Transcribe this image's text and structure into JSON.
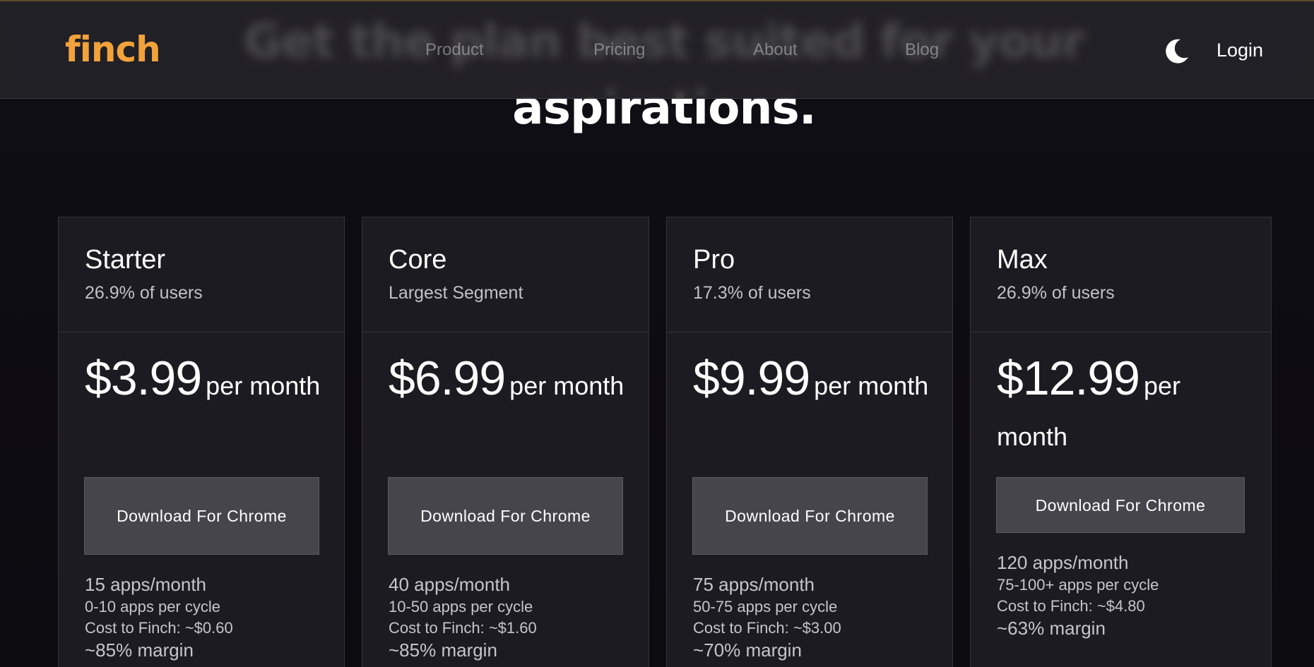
{
  "hero": {
    "title": "Get the plan best suited for your aspirations."
  },
  "nav": {
    "logo": "finch",
    "links": [
      "Product",
      "Pricing",
      "About",
      "Blog"
    ],
    "theme_icon": "moon-icon",
    "login": "Login"
  },
  "colors": {
    "brand": "#f2a23a",
    "background": "#0f0d14",
    "card": "#1c1b21",
    "button": "#46454c"
  },
  "plans": [
    {
      "name": "Starter",
      "sub": "26.9% of users",
      "price": "$3.99",
      "per": "per month",
      "button": "Download For Chrome",
      "apps": "15 apps/month",
      "cycle": "0-10 apps per cycle",
      "cost": "Cost to Finch: ~$0.60",
      "margin": "~85% margin"
    },
    {
      "name": "Core",
      "sub": "Largest Segment",
      "price": "$6.99",
      "per": "per month",
      "button": "Download For Chrome",
      "apps": "40 apps/month",
      "cycle": "10-50 apps per cycle",
      "cost": "Cost to Finch: ~$1.60",
      "margin": "~85% margin"
    },
    {
      "name": "Pro",
      "sub": "17.3% of users",
      "price": "$9.99",
      "per": "per month",
      "button": "Download For Chrome",
      "apps": "75 apps/month",
      "cycle": "50-75 apps per cycle",
      "cost": "Cost to Finch: ~$3.00",
      "margin": "~70% margin"
    },
    {
      "name": "Max",
      "sub": "26.9% of users",
      "price": "$12.99",
      "per": "per month",
      "button": "Download For Chrome",
      "apps": "120 apps/month",
      "cycle": "75-100+ apps per cycle",
      "cost": "Cost to Finch: ~$4.80",
      "margin": "~63% margin"
    }
  ]
}
